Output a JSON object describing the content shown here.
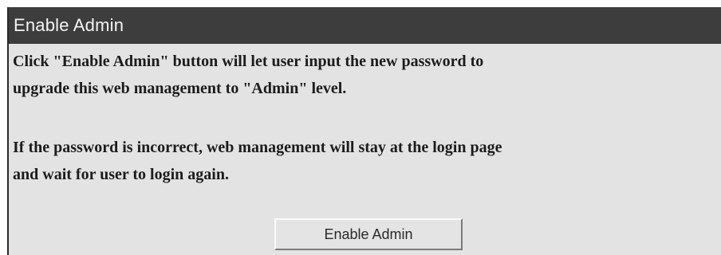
{
  "window": {
    "title": "Enable Admin"
  },
  "content": {
    "paragraph1_line1": "Click \"Enable Admin\" button will let user input the new password to",
    "paragraph1_line2": "upgrade this web management to \"Admin\" level.",
    "paragraph2_line1": "If the password is incorrect, web management will stay at the login page",
    "paragraph2_line2": "and wait for user to login again."
  },
  "actions": {
    "enable_admin_label": "Enable Admin"
  },
  "colors": {
    "title_bar_bg": "#3d3d3d",
    "title_text": "#f4f4f4",
    "panel_bg": "#e3e3e3",
    "body_text": "#1c1c1c"
  }
}
